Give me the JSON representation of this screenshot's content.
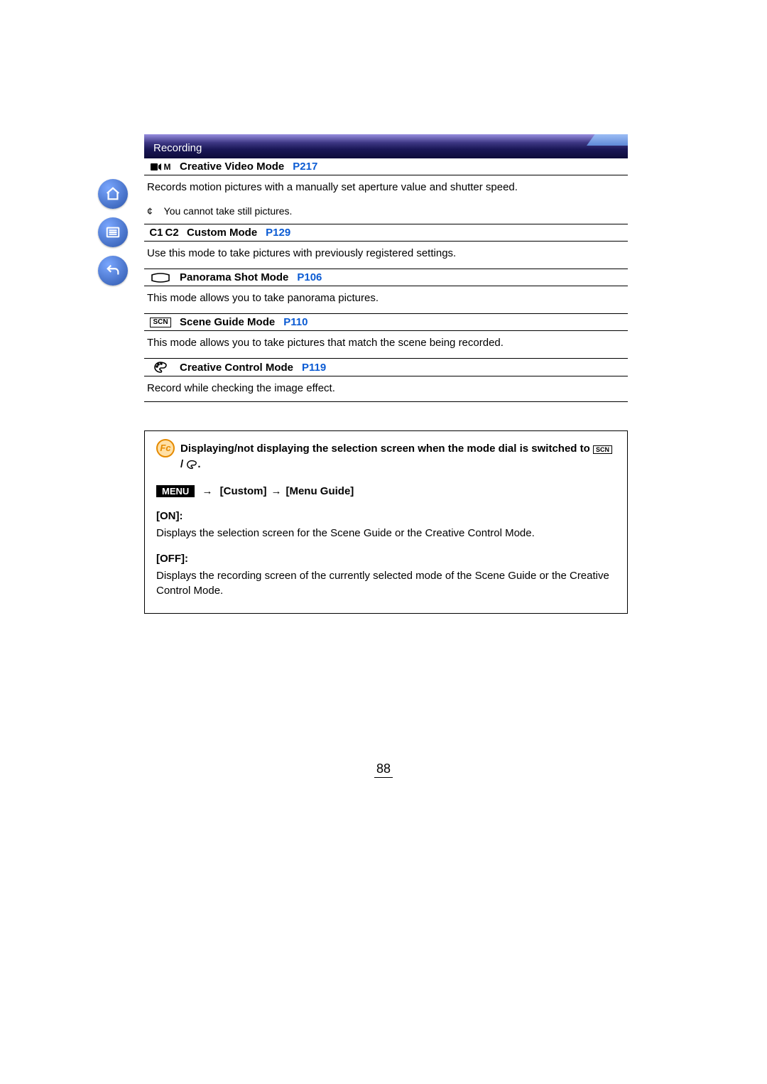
{
  "header": {
    "section": "Recording"
  },
  "modes": [
    {
      "icon": "video-m",
      "title": "Creative Video Mode",
      "link": "P217",
      "desc": "Records motion pictures with a manually set aperture value and shutter speed.",
      "note_marker": "¢",
      "note": "You cannot take still pictures."
    },
    {
      "icon": "c1c2",
      "c1": "C1",
      "c2": "C2",
      "title": "Custom Mode",
      "link": "P129",
      "desc": "Use this mode to take pictures with previously registered settings."
    },
    {
      "icon": "panorama",
      "title": "Panorama Shot Mode",
      "link": "P106",
      "desc": "This mode allows you to take panorama pictures."
    },
    {
      "icon": "scn",
      "icon_label": "SCN",
      "title": "Scene Guide Mode",
      "link": "P110",
      "desc": "This mode allows you to take pictures that match the scene being recorded."
    },
    {
      "icon": "palette",
      "title": "Creative Control Mode",
      "link": "P119",
      "desc": "Record while checking the image effect."
    }
  ],
  "callout": {
    "title_prefix": "Displaying/not displaying the selection screen when the mode dial is switched to ",
    "title_suffix": ".",
    "menu_badge": "MENU",
    "menu_path_1": "[Custom]",
    "menu_path_2": "[Menu Guide]",
    "on_label": "[ON]:",
    "on_text": "Displays the selection screen for the Scene Guide or the Creative Control Mode.",
    "off_label": "[OFF]:",
    "off_text": "Displays the recording screen of the currently selected mode of the Scene Guide or the Creative Control Mode."
  },
  "page_number": "88"
}
